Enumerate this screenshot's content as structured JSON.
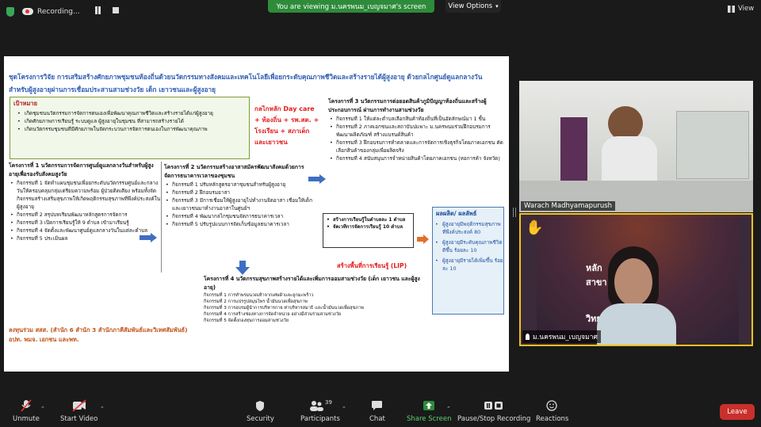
{
  "topbar": {
    "recording_label": "Recording...",
    "viewing_banner": "You are viewing ม.นครพนม_เบญจมาศ's screen",
    "view_options_label": "View Options",
    "view_label": "View"
  },
  "slide": {
    "headline": "ชุดโครงการวิจัย การเสริมสร้างศักยภาพชุมชนท้องถิ่นด้วยนวัตกรรมทางสังคมและเทคโนโลยีเพื่อยกระดับคุณภาพชีวิตและสร้างรายได้ผู้สูงอายุ ด้วยกลไกศูนย์ดูแลกลางวันสำหรับผู้สูงอายุผ่านการเชื่อมประสานสามช่วงวัย เด็ก เยาวชนและผู้สูงอายุ",
    "goal_title": "เป้าหมาย",
    "goals": [
      "เกิดชุมชนนวัตกรรมการจัดการตนเองเพื่อพัฒนาคุณภาพชีวิตและสร้างรายได้แก่ผู้สูงอายุ",
      "เกิดศักยภาพการเรียนรู้ ระบบดูแล ผู้สูงอายุในชุมชน ที่สามารถสร้างรายได้",
      "เกิดนวัตกรรมชุมชนที่มีศักยภาพในจัดกระบวนการจัดการตนเองในการพัฒนาคุณภาพ"
    ],
    "mechanism_note": "กลไกหลัก Day care + ท้องถิ่น + รพ.สต. + โรงเรียน + สภาเด็กและเยาวชน",
    "proj1": {
      "title": "โครงการที่ 1 นวัตกรรมการจัดการศูนย์ดูแลกลางวันสำหรับผู้สูงอายุเพื่อรองรับสังคมสูงวัย",
      "items": [
        "กิจกรรมที่ 1 จัดทำแผนชุมชนเพื่อยกระดับนวัตกรรมศูนย์และกลางวันให้ครอบคลุมกลุ่มเตรียมความพร้อม ผู้ป่วยติดเตียง พร้อมทั้งจัดกิจกรรมสร้างเสริมสุขภาพให้เกิดพฤติกรรมสุขภาพที่พึงค์ประสงค์ในผู้สูงอายุ",
        "กิจกรรมที่ 2 สรุปบทเรียนพัฒนาหลักสูตรการจัดการ",
        "กิจกรรมที่ 3 เปิดการเรียนรู้ให้ 9 ตำบล เข้ามาเรียนรู้",
        "กิจกรรมที่ 4 จัดตั้งและพัฒนาศูนย์ดูแลกลางวันในแต่ละตำบล",
        "กิจกรรมที่ 5 ประเมินผล"
      ]
    },
    "partners": "ลงทุนร่วม สสส. (สำนัก 6 สำนัก 3 สำนักภาคีสัมพันธ์และวิเทศสัมพันธ์) อปท. พมจ. เอกชน และพท.",
    "proj2": {
      "title": "โครงการที่ 2 นวัตกรรมสร้างอาสาสมัครพัฒนาสังคมด้วยการจัดการธนาคารเวลาของชุมชน",
      "items": [
        "กิจกรรมที่ 1 ปรับหลักสูตรอาสาชุมชนสำหรับผู้สูงอายุ",
        "กิจกรรมที่ 2 ฝึกอบรมอาสา",
        "กิจกรรมที่ 3 มีการเชื่อมให้ผู้สูงอายุไปทำงานจิตอาสา เชื่อมให้เด็กและเยาวชนมาทำงานอาสาในศูนย์ฯ",
        "กิจกรรมที่ 4 พัฒนากลไกชุมชนจัดการธนาคารเวลา",
        "กิจกรรมที่ 5 ปรับรูปแบบการจัดเก็บข้อมูลธนาคารเวลา"
      ]
    },
    "proj3": {
      "title": "โครงการที่ 3 นวัตกรรมการต่อยอดสินค้าภูมิปัญญาท้องถิ่นและสร้างผู้ประกอบการณ์ ผ่านการทำงานสามช่วงวัย",
      "items": [
        "กิจกรรมที่ 1 ให้แต่ละตำบลเลือกสินค้าท้องถิ่นที่เป็นอัตลักษณ์มา 1 ชิ้น",
        "กิจกรรมที่ 2 ภาคเอกชนและสถาบันปแพาะ ม.นครพนมร่วมฝึกอบรมการพัฒนาผลิตภัณฑ์ สร้างแบรนด์สินค้า",
        "กิจกรรมที่ 3 ฝึกอบรมการทำตลาดและการจัดการเชิงธุรกิจโดยภาคเอกชน คัดเลือกสินค้าของกลุ่มเพื่อผลิตจริง",
        "กิจกรรมที่ 4 สนับสนุนการจำหน่ายสินค้าโดยภาคเอกชน (หอการค้า จังหวัด)"
      ]
    },
    "learning_box": [
      "สร้างการเรียนรู้ในตำบลละ 1 ตำบล",
      "จัดเวทีการจัดการเรียนรู้ 10 ตำบล"
    ],
    "lip_label": "สร้างพื้นที่การเรียนรู้ (LIP)",
    "outcome": {
      "title": "ผลผลิต/ ผลลัพธ์",
      "items": [
        "ผู้สูงอายุมีพฤติกรรมสุขภาพที่พึงค์ประสงค์ 80",
        "ผู้สูงอายุมีระดับคุณภาพชีวิตดีขึ้น ร้อยละ 10",
        "ผู้สูงอายุมีรายได้เพิ่มขึ้น ร้อยละ 10"
      ]
    },
    "proj4": {
      "title": "โครงการที่ 4 นวัตกรรมสุขภาพสร้างรายได้และเพิ่มการออมสามช่วงวัย (เด็ก เยาวชน และผู้สูงอายุ)",
      "items": [
        "กิจกรรมที่ 1 การทำพรมนวดเท้าจากเศษผ้าและลูกมะพร้าว",
        "กิจกรรมที่ 2 การแปรรูปสมุนไพร น้ำมันนวดเพื่อสุขภาพ",
        "กิจกรรมที่ 3 การอบรมผู้นำการบริหารกาย ท่าบริหารสมาธิ และน้ำมันนวดเพื่อสุขภาพ",
        "กิจกรรมที่ 4 การสร้างช่องทางการจัดจำหน่าย อย่างมีส่วนร่วมสามช่วงวัย",
        "กิจกรรมที่ 5 จัดตั้งกองทุนการออมสามช่วงวัย"
      ]
    }
  },
  "participants": {
    "tile1_name": "Warach Madhyamapurush",
    "tile2_name": "ม.นครพนม_เบญจมาศ",
    "tile2_bg_text_1": "หลัก",
    "tile2_bg_text_2": "สาขา",
    "tile2_bg_text_3": "วิทย"
  },
  "toolbar": {
    "unmute": "Unmute",
    "start_video": "Start Video",
    "security": "Security",
    "participants": "Participants",
    "participants_count": "39",
    "chat": "Chat",
    "share_screen": "Share Screen",
    "pause_recording": "Pause/Stop Recording",
    "reactions": "Reactions",
    "leave": "Leave"
  },
  "colors": {
    "share_green": "#2e8b3a",
    "leave_red": "#c9302c",
    "active_speaker": "#f4c21a",
    "headline_blue": "#2e5db3"
  }
}
